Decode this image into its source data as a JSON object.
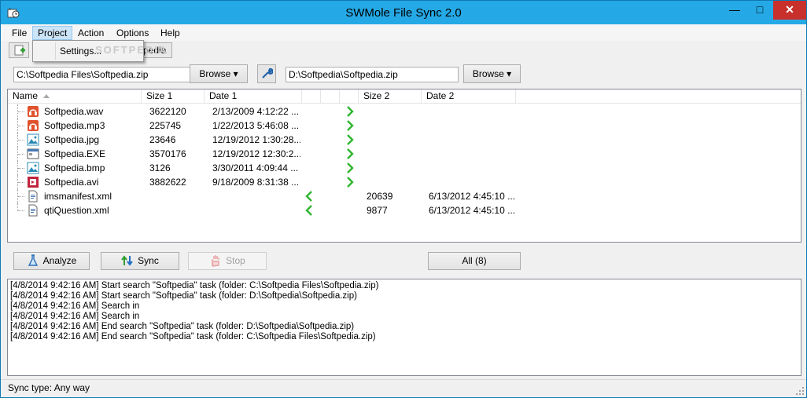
{
  "window": {
    "title": "SWMole File Sync 2.0"
  },
  "menu": [
    "File",
    "Project",
    "Action",
    "Options",
    "Help"
  ],
  "dropdown": {
    "item": "Settings..."
  },
  "watermark": "SOFTPEDIA",
  "toolbar": {
    "partial_label": "pedia"
  },
  "paths": {
    "left": "C:\\Softpedia Files\\Softpedia.zip",
    "right": "D:\\Softpedia\\Softpedia.zip",
    "browse_label": "Browse ▾"
  },
  "columns": [
    "Name",
    "Size 1",
    "Date 1",
    "Size 2",
    "Date 2"
  ],
  "files": [
    {
      "name": "Softpedia.wav",
      "size1": "3622120",
      "date1": "2/13/2009 4:12:22 ...",
      "size2": "",
      "date2": "",
      "direction": "right",
      "icon": "audio-file-icon"
    },
    {
      "name": "Softpedia.mp3",
      "size1": "225745",
      "date1": "1/22/2013 5:46:08 ...",
      "size2": "",
      "date2": "",
      "direction": "right",
      "icon": "audio-file-icon"
    },
    {
      "name": "Softpedia.jpg",
      "size1": "23646",
      "date1": "12/19/2012 1:30:28...",
      "size2": "",
      "date2": "",
      "direction": "right",
      "icon": "image-file-icon"
    },
    {
      "name": "Softpedia.EXE",
      "size1": "3570176",
      "date1": "12/19/2012 12:30:2...",
      "size2": "",
      "date2": "",
      "direction": "right",
      "icon": "exe-file-icon"
    },
    {
      "name": "Softpedia.bmp",
      "size1": "3126",
      "date1": "3/30/2011 4:09:44 ...",
      "size2": "",
      "date2": "",
      "direction": "right",
      "icon": "image-file-icon"
    },
    {
      "name": "Softpedia.avi",
      "size1": "3882622",
      "date1": "9/18/2009 8:31:38 ...",
      "size2": "",
      "date2": "",
      "direction": "right",
      "icon": "video-file-icon"
    },
    {
      "name": "imsmanifest.xml",
      "size1": "",
      "date1": "",
      "size2": "20639",
      "date2": "6/13/2012 4:45:10 ...",
      "direction": "left",
      "icon": "xml-file-icon"
    },
    {
      "name": "qtiQuestion.xml",
      "size1": "",
      "date1": "",
      "size2": "9877",
      "date2": "6/13/2012 4:45:10 ...",
      "direction": "left",
      "icon": "xml-file-icon"
    }
  ],
  "buttons": {
    "analyze": "Analyze",
    "sync": "Sync",
    "stop": "Stop",
    "filter": "All (8)"
  },
  "log": [
    "[4/8/2014 9:42:16 AM] Start search \"Softpedia\" task (folder: C:\\Softpedia Files\\Softpedia.zip)",
    "[4/8/2014 9:42:16 AM] Start search \"Softpedia\" task (folder: D:\\Softpedia\\Softpedia.zip)",
    "[4/8/2014 9:42:16 AM] Search in",
    "[4/8/2014 9:42:16 AM] Search in",
    "[4/8/2014 9:42:16 AM] End search \"Softpedia\" task (folder: D:\\Softpedia\\Softpedia.zip)",
    "[4/8/2014 9:42:16 AM] End search \"Softpedia\" task (folder: C:\\Softpedia Files\\Softpedia.zip)"
  ],
  "status": "Sync type: Any way",
  "colors": {
    "titlebar": "#25a9e6",
    "close": "#c7302b",
    "arrow": "#2fb52f",
    "audio": "#e0522d",
    "image": "#2a8bb6",
    "video": "#c0243c"
  }
}
